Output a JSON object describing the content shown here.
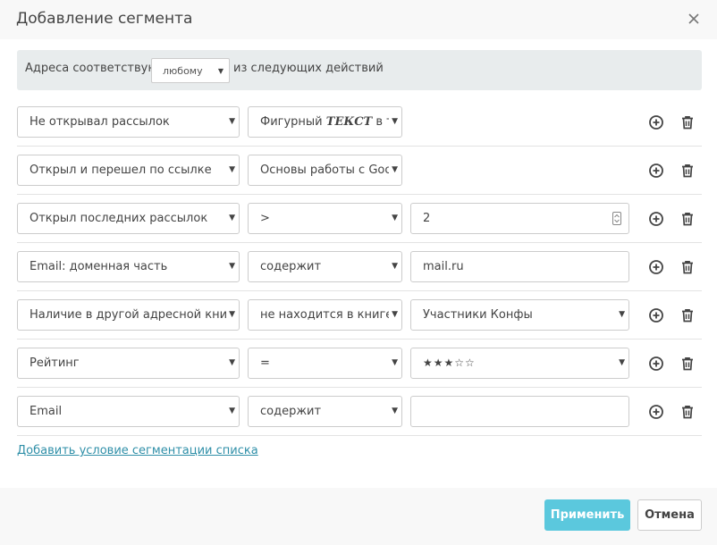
{
  "dialog": {
    "title": "Добавление сегмента",
    "close_icon": "close-icon"
  },
  "match": {
    "prefix": "Адреса соответствуют",
    "selected": "любому",
    "suffix": "из следующих действий"
  },
  "rows": [
    {
      "field1": "Не открывал рассылок",
      "field2_prefix": "Фигурный",
      "field2_bold": "ТЕКСТ",
      "field2_suffix": "в т",
      "field3": ""
    },
    {
      "field1": "Открыл и перешел по ссылке",
      "field2": "Основы работы с Goo",
      "field3": ""
    },
    {
      "field1": "Открыл последних рассылок",
      "field2": ">",
      "field3": "2"
    },
    {
      "field1": "Email: доменная часть",
      "field2": "содержит",
      "field3": "mail.ru"
    },
    {
      "field1": "Наличие в другой адресной книг",
      "field2": "не находится в книге",
      "field3": "Участники Конфы"
    },
    {
      "field1": "Рейтинг",
      "field2": "=",
      "field3": "★★★☆☆"
    },
    {
      "field1": "Email",
      "field2": "содержит",
      "field3": ""
    }
  ],
  "add_condition_link": "Добавить условие сегментации списка",
  "buttons": {
    "apply": "Применить",
    "cancel": "Отмена"
  },
  "colors": {
    "accent": "#5bc8dd",
    "link": "#2f8fa8",
    "match_bar_bg": "#e8eced"
  }
}
